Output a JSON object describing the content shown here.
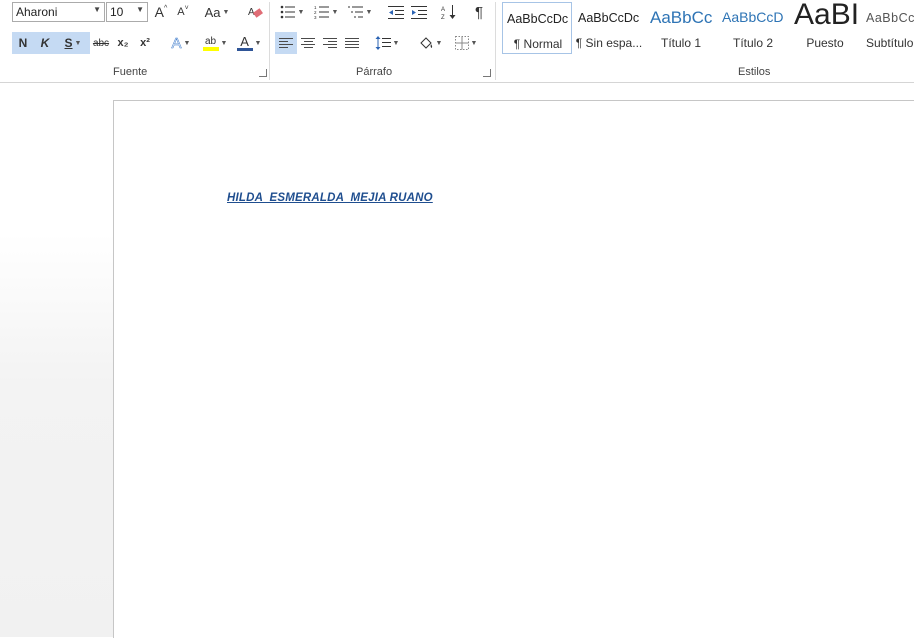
{
  "ribbon": {
    "font_group": {
      "label": "Fuente",
      "font_name": "Aharoni",
      "font_size": "10",
      "grow_label": "A",
      "shrink_label": "A",
      "case_label": "Aa",
      "bold_label": "N",
      "italic_label": "K",
      "underline_label": "S",
      "strike_label": "abc",
      "subscript_label": "x₂",
      "superscript_label": "x²",
      "text_effects_label": "A",
      "highlight_label": "ab",
      "font_color_label": "A"
    },
    "paragraph_group": {
      "label": "Párrafo",
      "pilcrow": "¶"
    },
    "styles_group": {
      "label": "Estilos",
      "items": [
        {
          "preview": "AaBbCcDc",
          "name": "¶ Normal"
        },
        {
          "preview": "AaBbCcDc",
          "name": "¶ Sin espa..."
        },
        {
          "preview": "AaBbCc",
          "name": "Título 1"
        },
        {
          "preview": "AaBbCcD",
          "name": "Título 2"
        },
        {
          "preview": "AaBI",
          "name": "Puesto"
        },
        {
          "preview": "AaBbCcD",
          "name": "Subtítulo"
        }
      ]
    }
  },
  "document": {
    "text": "HILDA  ESMERALDA  MEJIA RUANO"
  },
  "colors": {
    "accent": "#1f4e8f",
    "selected_button": "#c5daf3",
    "highlight_yellow": "#ffff00",
    "font_color_bar": "#2f5597"
  }
}
